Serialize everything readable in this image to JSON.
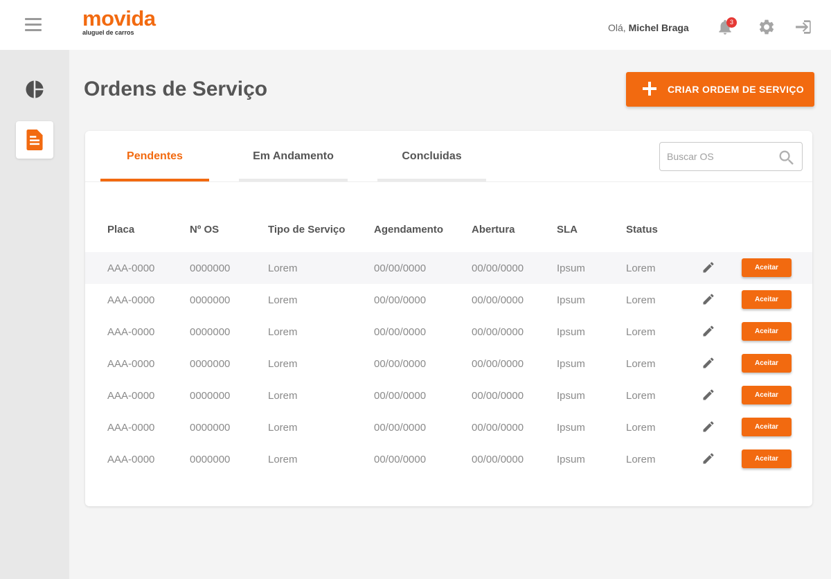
{
  "brand": {
    "name": "movida",
    "tagline": "aluguel de carros",
    "accent": "#f26a10"
  },
  "header": {
    "greeting_prefix": "Olá,",
    "user_name": "Michel Braga",
    "notifications_count": "3",
    "icons": [
      "menu-icon",
      "bell-icon",
      "gear-icon",
      "logout-icon"
    ]
  },
  "sidebar": {
    "items": [
      {
        "icon": "pie-chart-icon",
        "active": false
      },
      {
        "icon": "document-icon",
        "active": true
      }
    ]
  },
  "page": {
    "title": "Ordens de Serviço",
    "create_button": "CRIAR ORDEM DE SERVIÇO"
  },
  "tabs": [
    {
      "label": "Pendentes",
      "active": true
    },
    {
      "label": "Em Andamento",
      "active": false
    },
    {
      "label": "Concluidas",
      "active": false
    }
  ],
  "search": {
    "placeholder": "Buscar OS"
  },
  "table": {
    "columns": [
      "Placa",
      "Nº OS",
      "Tipo de Serviço",
      "Agendamento",
      "Abertura",
      "SLA",
      "Status"
    ],
    "accept_label": "Aceitar",
    "rows": [
      [
        "AAA-0000",
        "0000000",
        "Lorem",
        "00/00/0000",
        "00/00/0000",
        "Ipsum",
        "Lorem"
      ],
      [
        "AAA-0000",
        "0000000",
        "Lorem",
        "00/00/0000",
        "00/00/0000",
        "Ipsum",
        "Lorem"
      ],
      [
        "AAA-0000",
        "0000000",
        "Lorem",
        "00/00/0000",
        "00/00/0000",
        "Ipsum",
        "Lorem"
      ],
      [
        "AAA-0000",
        "0000000",
        "Lorem",
        "00/00/0000",
        "00/00/0000",
        "Ipsum",
        "Lorem"
      ],
      [
        "AAA-0000",
        "0000000",
        "Lorem",
        "00/00/0000",
        "00/00/0000",
        "Ipsum",
        "Lorem"
      ],
      [
        "AAA-0000",
        "0000000",
        "Lorem",
        "00/00/0000",
        "00/00/0000",
        "Ipsum",
        "Lorem"
      ],
      [
        "AAA-0000",
        "0000000",
        "Lorem",
        "00/00/0000",
        "00/00/0000",
        "Ipsum",
        "Lorem"
      ]
    ]
  }
}
